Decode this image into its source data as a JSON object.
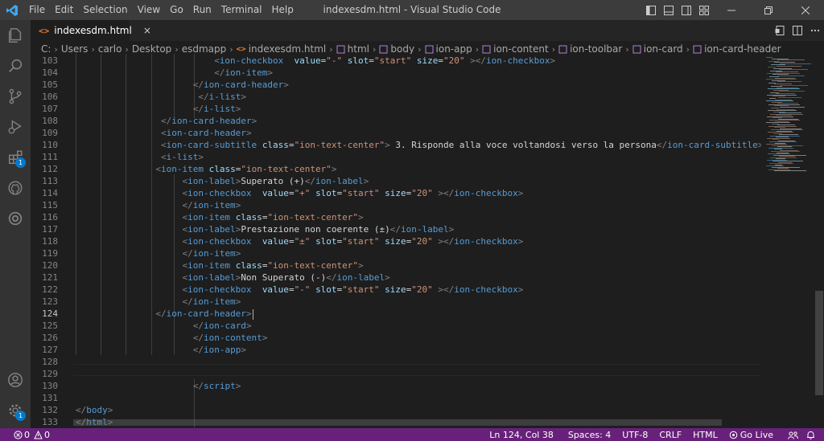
{
  "window": {
    "title": "indexesdm.html - Visual Studio Code"
  },
  "menu": [
    "File",
    "Edit",
    "Selection",
    "View",
    "Go",
    "Run",
    "Terminal",
    "Help"
  ],
  "activity_bar": {
    "items": [
      {
        "icon": "explorer-icon"
      },
      {
        "icon": "search-icon"
      },
      {
        "icon": "source-control-icon"
      },
      {
        "icon": "run-debug-icon"
      },
      {
        "icon": "extensions-icon",
        "badge": "1"
      },
      {
        "icon": "github-icon"
      },
      {
        "icon": "remote-icon"
      }
    ],
    "bottom": [
      {
        "icon": "account-icon"
      },
      {
        "icon": "manage-gear-icon",
        "badge": "1"
      }
    ]
  },
  "tab": {
    "label": "indexesdm.html",
    "close": "×"
  },
  "breadcrumbs": [
    "C:",
    "Users",
    "carlo",
    "Desktop",
    "esdmapp",
    "indexesdm.html",
    "html",
    "body",
    "ion-app",
    "ion-content",
    "ion-toolbar",
    "ion-card",
    "ion-card-header"
  ],
  "editor": {
    "current_line": "124",
    "lines": [
      {
        "n": "103",
        "t": [
          [
            "s",
            "                          "
          ],
          [
            "b",
            "<"
          ],
          [
            "g",
            "ion-checkbox"
          ],
          [
            "s",
            "  "
          ],
          [
            "a",
            "value"
          ],
          [
            "x",
            "="
          ],
          [
            "r",
            "\"-\""
          ],
          [
            "s",
            " "
          ],
          [
            "a",
            "slot"
          ],
          [
            "x",
            "="
          ],
          [
            "r",
            "\"start\""
          ],
          [
            "s",
            " "
          ],
          [
            "a",
            "size"
          ],
          [
            "x",
            "="
          ],
          [
            "r",
            "\"20\""
          ],
          [
            "s",
            " "
          ],
          [
            "b",
            "></"
          ],
          [
            "g",
            "ion-checkbox"
          ],
          [
            "b",
            ">"
          ]
        ]
      },
      {
        "n": "104",
        "t": [
          [
            "s",
            "                          "
          ],
          [
            "b",
            "</"
          ],
          [
            "g",
            "ion-item"
          ],
          [
            "b",
            ">"
          ]
        ]
      },
      {
        "n": "105",
        "t": [
          [
            "s",
            "                      "
          ],
          [
            "b",
            "</"
          ],
          [
            "g",
            "ion-card-header"
          ],
          [
            "b",
            ">"
          ]
        ]
      },
      {
        "n": "106",
        "t": [
          [
            "s",
            "                       "
          ],
          [
            "b",
            "</"
          ],
          [
            "g",
            "i-list"
          ],
          [
            "b",
            ">"
          ]
        ]
      },
      {
        "n": "107",
        "t": [
          [
            "s",
            "                      "
          ],
          [
            "b",
            "</"
          ],
          [
            "g",
            "i-list"
          ],
          [
            "b",
            ">"
          ]
        ]
      },
      {
        "n": "108",
        "t": [
          [
            "s",
            "                "
          ],
          [
            "b",
            "</"
          ],
          [
            "g",
            "ion-card-header"
          ],
          [
            "b",
            ">"
          ]
        ]
      },
      {
        "n": "109",
        "t": [
          [
            "s",
            "                "
          ],
          [
            "b",
            "<"
          ],
          [
            "g",
            "ion-card-header"
          ],
          [
            "b",
            ">"
          ]
        ]
      },
      {
        "n": "110",
        "t": [
          [
            "s",
            "                "
          ],
          [
            "b",
            "<"
          ],
          [
            "g",
            "ion-card-subtitle"
          ],
          [
            "s",
            " "
          ],
          [
            "a",
            "class"
          ],
          [
            "x",
            "="
          ],
          [
            "r",
            "\"ion-text-center\""
          ],
          [
            "b",
            ">"
          ],
          [
            "x",
            " 3. Risponde alla voce voltandosi verso la persona"
          ],
          [
            "b",
            "</"
          ],
          [
            "g",
            "ion-card-subtitle"
          ],
          [
            "b",
            ">"
          ]
        ]
      },
      {
        "n": "111",
        "t": [
          [
            "s",
            "                "
          ],
          [
            "b",
            "<"
          ],
          [
            "g",
            "i-list"
          ],
          [
            "b",
            ">"
          ]
        ]
      },
      {
        "n": "112",
        "t": [
          [
            "s",
            "               "
          ],
          [
            "b",
            "<"
          ],
          [
            "g",
            "ion-item"
          ],
          [
            "s",
            " "
          ],
          [
            "a",
            "class"
          ],
          [
            "x",
            "="
          ],
          [
            "r",
            "\"ion-text-center\""
          ],
          [
            "b",
            ">"
          ]
        ]
      },
      {
        "n": "113",
        "t": [
          [
            "s",
            "                    "
          ],
          [
            "b",
            "<"
          ],
          [
            "g",
            "ion-label"
          ],
          [
            "b",
            ">"
          ],
          [
            "x",
            "Superato (+)"
          ],
          [
            "b",
            "</"
          ],
          [
            "g",
            "ion-label"
          ],
          [
            "b",
            ">"
          ]
        ]
      },
      {
        "n": "114",
        "t": [
          [
            "s",
            "                    "
          ],
          [
            "b",
            "<"
          ],
          [
            "g",
            "ion-checkbox"
          ],
          [
            "s",
            "  "
          ],
          [
            "a",
            "value"
          ],
          [
            "x",
            "="
          ],
          [
            "r",
            "\"+\""
          ],
          [
            "s",
            " "
          ],
          [
            "a",
            "slot"
          ],
          [
            "x",
            "="
          ],
          [
            "r",
            "\"start\""
          ],
          [
            "s",
            " "
          ],
          [
            "a",
            "size"
          ],
          [
            "x",
            "="
          ],
          [
            "r",
            "\"20\""
          ],
          [
            "s",
            " "
          ],
          [
            "b",
            "></"
          ],
          [
            "g",
            "ion-checkbox"
          ],
          [
            "b",
            ">"
          ]
        ]
      },
      {
        "n": "115",
        "t": [
          [
            "s",
            "                    "
          ],
          [
            "b",
            "</"
          ],
          [
            "g",
            "ion-item"
          ],
          [
            "b",
            ">"
          ]
        ]
      },
      {
        "n": "116",
        "t": [
          [
            "s",
            "                    "
          ],
          [
            "b",
            "<"
          ],
          [
            "g",
            "ion-item"
          ],
          [
            "s",
            " "
          ],
          [
            "a",
            "class"
          ],
          [
            "x",
            "="
          ],
          [
            "r",
            "\"ion-text-center\""
          ],
          [
            "b",
            ">"
          ]
        ]
      },
      {
        "n": "117",
        "t": [
          [
            "s",
            "                    "
          ],
          [
            "b",
            "<"
          ],
          [
            "g",
            "ion-label"
          ],
          [
            "b",
            ">"
          ],
          [
            "x",
            "Prestazione non coerente (±)"
          ],
          [
            "b",
            "</"
          ],
          [
            "g",
            "ion-label"
          ],
          [
            "b",
            ">"
          ]
        ]
      },
      {
        "n": "118",
        "t": [
          [
            "s",
            "                    "
          ],
          [
            "b",
            "<"
          ],
          [
            "g",
            "ion-checkbox"
          ],
          [
            "s",
            "  "
          ],
          [
            "a",
            "value"
          ],
          [
            "x",
            "="
          ],
          [
            "r",
            "\"±\""
          ],
          [
            "s",
            " "
          ],
          [
            "a",
            "slot"
          ],
          [
            "x",
            "="
          ],
          [
            "r",
            "\"start\""
          ],
          [
            "s",
            " "
          ],
          [
            "a",
            "size"
          ],
          [
            "x",
            "="
          ],
          [
            "r",
            "\"20\""
          ],
          [
            "s",
            " "
          ],
          [
            "b",
            "></"
          ],
          [
            "g",
            "ion-checkbox"
          ],
          [
            "b",
            ">"
          ]
        ]
      },
      {
        "n": "119",
        "t": [
          [
            "s",
            "                    "
          ],
          [
            "b",
            "</"
          ],
          [
            "g",
            "ion-item"
          ],
          [
            "b",
            ">"
          ]
        ]
      },
      {
        "n": "120",
        "t": [
          [
            "s",
            "                    "
          ],
          [
            "b",
            "<"
          ],
          [
            "g",
            "ion-item"
          ],
          [
            "s",
            " "
          ],
          [
            "a",
            "class"
          ],
          [
            "x",
            "="
          ],
          [
            "r",
            "\"ion-text-center\""
          ],
          [
            "b",
            ">"
          ]
        ]
      },
      {
        "n": "121",
        "t": [
          [
            "s",
            "                    "
          ],
          [
            "b",
            "<"
          ],
          [
            "g",
            "ion-label"
          ],
          [
            "b",
            ">"
          ],
          [
            "x",
            "Non Superato (-)"
          ],
          [
            "b",
            "</"
          ],
          [
            "g",
            "ion-label"
          ],
          [
            "b",
            ">"
          ]
        ]
      },
      {
        "n": "122",
        "t": [
          [
            "s",
            "                    "
          ],
          [
            "b",
            "<"
          ],
          [
            "g",
            "ion-checkbox"
          ],
          [
            "s",
            "  "
          ],
          [
            "a",
            "value"
          ],
          [
            "x",
            "="
          ],
          [
            "r",
            "\"-\""
          ],
          [
            "s",
            " "
          ],
          [
            "a",
            "slot"
          ],
          [
            "x",
            "="
          ],
          [
            "r",
            "\"start\""
          ],
          [
            "s",
            " "
          ],
          [
            "a",
            "size"
          ],
          [
            "x",
            "="
          ],
          [
            "r",
            "\"20\""
          ],
          [
            "s",
            " "
          ],
          [
            "b",
            "></"
          ],
          [
            "g",
            "ion-checkbox"
          ],
          [
            "b",
            ">"
          ]
        ]
      },
      {
        "n": "123",
        "t": [
          [
            "s",
            "                    "
          ],
          [
            "b",
            "</"
          ],
          [
            "g",
            "ion-item"
          ],
          [
            "b",
            ">"
          ]
        ]
      },
      {
        "n": "124",
        "t": [
          [
            "s",
            "               "
          ],
          [
            "b",
            "</"
          ],
          [
            "g",
            "ion-card-header"
          ],
          [
            "b",
            ">"
          ]
        ],
        "cursor": true
      },
      {
        "n": "125",
        "t": [
          [
            "s",
            "                      "
          ],
          [
            "b",
            "</"
          ],
          [
            "g",
            "ion-card"
          ],
          [
            "b",
            ">"
          ]
        ]
      },
      {
        "n": "126",
        "t": [
          [
            "s",
            "                      "
          ],
          [
            "b",
            "</"
          ],
          [
            "g",
            "ion-content"
          ],
          [
            "b",
            ">"
          ]
        ]
      },
      {
        "n": "127",
        "t": [
          [
            "s",
            "                      "
          ],
          [
            "b",
            "</"
          ],
          [
            "g",
            "ion-app"
          ],
          [
            "b",
            ">"
          ]
        ]
      },
      {
        "n": "128",
        "t": []
      },
      {
        "n": "129",
        "t": []
      },
      {
        "n": "130",
        "t": [
          [
            "s",
            "                      "
          ],
          [
            "b",
            "</"
          ],
          [
            "g",
            "script"
          ],
          [
            "b",
            ">"
          ]
        ]
      },
      {
        "n": "131",
        "t": []
      },
      {
        "n": "132",
        "t": [
          [
            "b",
            "</"
          ],
          [
            "g",
            "body"
          ],
          [
            "b",
            ">"
          ]
        ]
      },
      {
        "n": "133",
        "t": [
          [
            "b",
            "</"
          ],
          [
            "g",
            "html"
          ],
          [
            "b",
            ">"
          ]
        ]
      }
    ]
  },
  "status_bar": {
    "errors": "0",
    "warnings": "0",
    "position": "Ln 124, Col 38",
    "spaces": "Spaces: 4",
    "encoding": "UTF-8",
    "eol": "CRLF",
    "language": "HTML",
    "live": "Go Live"
  },
  "colors": {
    "status_bg": "#68217a",
    "tag": "#569cd6",
    "attribute": "#9cdcfe",
    "string": "#ce9178",
    "text": "#d4d4d4",
    "bracket": "#808080"
  }
}
